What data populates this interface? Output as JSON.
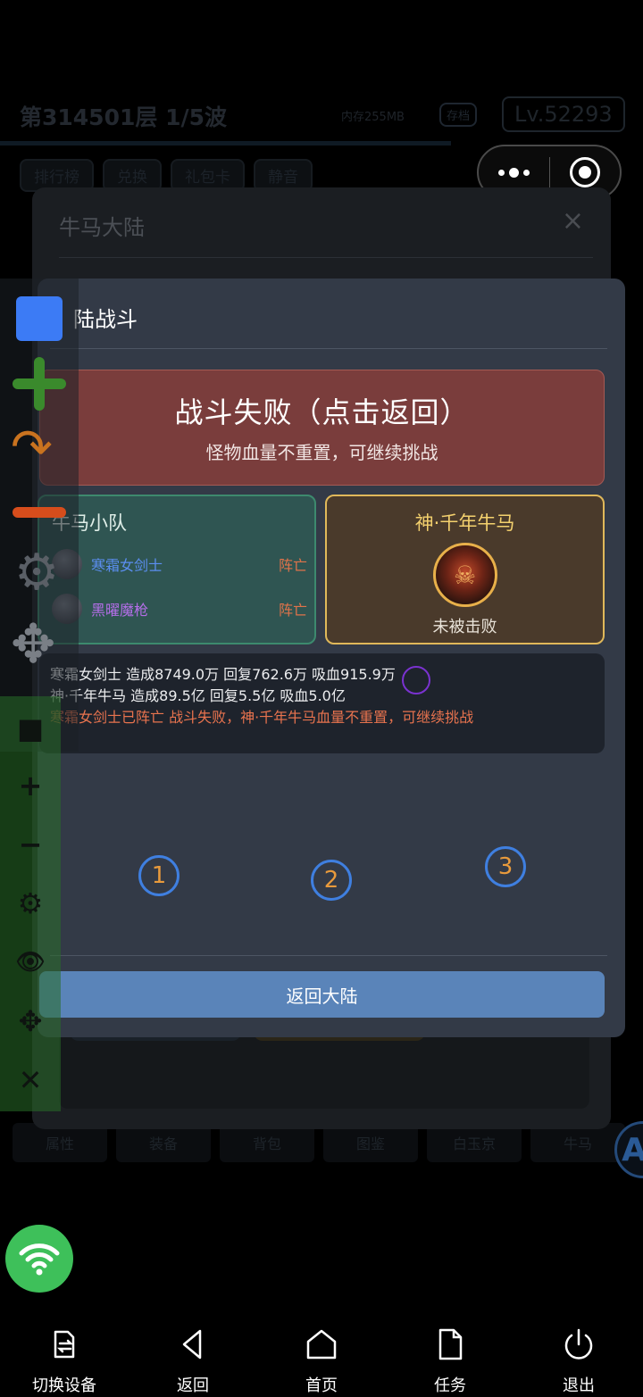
{
  "background": {
    "floor_text": "第314501层  1/5波",
    "memory_text": "内存255MB",
    "save_label": "存档",
    "level_text": "Lv.52293",
    "tabs": [
      "排行榜",
      "兑换",
      "礼包卡",
      "静音"
    ],
    "bottom_tabs": [
      "属性",
      "装备",
      "背包",
      "图鉴",
      "白玉京",
      "牛马"
    ],
    "side_button_letter": "A"
  },
  "under_dialog": {
    "title": "牛马大陆",
    "close_glyph": "×"
  },
  "battle": {
    "title": "陆战斗",
    "result_main": "战斗失败（点击返回）",
    "result_sub": "怪物血量不重置，可继续挑战",
    "team": {
      "title": "牛马小队",
      "members": [
        {
          "name": "寒霜女剑士",
          "status": "阵亡",
          "color": "#5b8ef0"
        },
        {
          "name": "黑曜魔枪",
          "status": "阵亡",
          "color": "#b46ee8"
        }
      ]
    },
    "boss": {
      "title": "神·千年牛马",
      "status": "未被击败"
    },
    "log": [
      "寒霜女剑士 造成8749.0万 回复762.6万 吸血915.9万",
      "神·千年牛马 造成89.5亿 回复5.5亿 吸血5.0亿",
      "寒霜女剑士已阵亡 战斗失败，神·千年牛马血量不重置，可继续挑战"
    ],
    "steps": [
      "1",
      "2",
      "3"
    ],
    "return_label": "返回大陆"
  },
  "tool_overlay": {
    "secondary_glyphs": [
      "■",
      "+",
      "−",
      "⚙",
      "👁",
      "✥",
      "✕"
    ]
  },
  "nav": {
    "items": [
      {
        "label": "切换设备",
        "icon": "switch-device-icon"
      },
      {
        "label": "返回",
        "icon": "back-icon"
      },
      {
        "label": "首页",
        "icon": "home-icon"
      },
      {
        "label": "任务",
        "icon": "task-icon"
      },
      {
        "label": "退出",
        "icon": "power-icon"
      }
    ]
  },
  "colors": {
    "result_bg": "#7a3d3c",
    "team_bg": "#2f5552",
    "boss_border": "#e0b85a",
    "return_button": "#5a84b9",
    "death_status": "#e0734a",
    "log_failure": "#e8734e"
  }
}
